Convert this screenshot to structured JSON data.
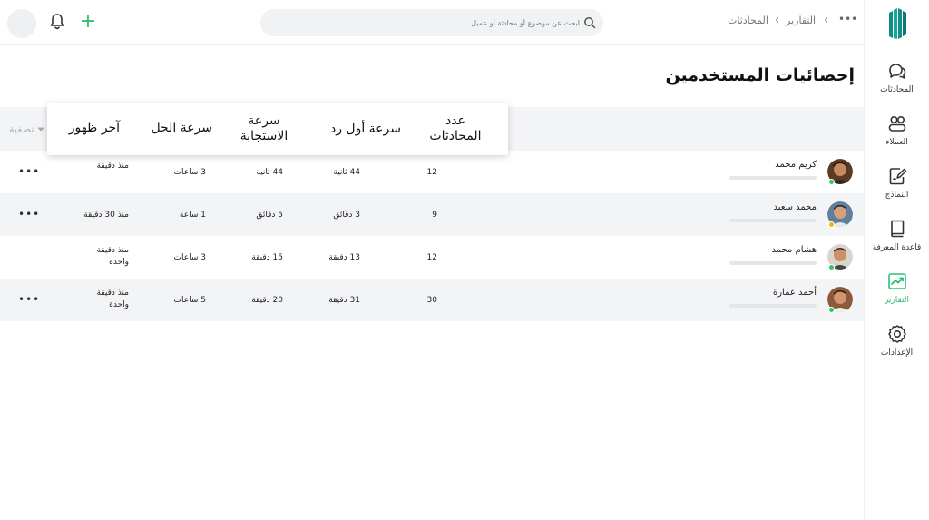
{
  "topbar": {
    "search_placeholder": "ابحث عن موضوع أو محادثة أو عميل...",
    "breadcrumb": [
      "التقارير",
      "المحادثات"
    ],
    "more": "•••"
  },
  "sidebar": {
    "items": [
      {
        "label": "المحادثات",
        "icon": "chat-bubbles-icon"
      },
      {
        "label": "العملاء",
        "icon": "users-icon"
      },
      {
        "label": "النماذج",
        "icon": "form-edit-icon"
      },
      {
        "label": "قاعدة المعرفة",
        "icon": "book-icon"
      },
      {
        "label": "التقارير",
        "icon": "chart-trend-icon",
        "active": true
      },
      {
        "label": "الإعدادات",
        "icon": "gear-icon"
      }
    ]
  },
  "page": {
    "title": "إحصائيات المستخدمين",
    "filter_label": "تصفية"
  },
  "table": {
    "headers": {
      "conversations": "عدد المحادثات",
      "first_reply": "سرعة أول رد",
      "response": "سرعة الاستجابة",
      "resolution": "سرعة الحل",
      "last_seen": "آخر ظهور"
    },
    "rows": [
      {
        "name": "كريم محمد",
        "status": "online",
        "conversations": "12",
        "first_reply": "44 ثانية",
        "response": "44 ثانية",
        "resolution": "3 ساعات",
        "last_seen": "منذ دقيقة",
        "more": "•••"
      },
      {
        "name": "محمد سعيد",
        "status": "away",
        "conversations": "9",
        "first_reply": "3 دقائق",
        "response": "5 دقائق",
        "resolution": "1 ساعة",
        "last_seen": "منذ 30 دقيقة",
        "more": "•••"
      },
      {
        "name": "هشام محمد",
        "status": "online",
        "conversations": "12",
        "first_reply": "13 دقيقة",
        "response": "15 دقيقة",
        "resolution": "3 ساعات",
        "last_seen": "منذ دقيقة واحدة",
        "more": ""
      },
      {
        "name": "أحمد عمارة",
        "status": "online",
        "conversations": "30",
        "first_reply": "31 دقيقة",
        "response": "20 دقيقة",
        "resolution": "5 ساعات",
        "last_seen": "منذ دقيقة واحدة",
        "more": "•••"
      }
    ]
  },
  "colors": {
    "accent": "#2fbf71",
    "online": "#34c759",
    "away": "#f5b400"
  }
}
